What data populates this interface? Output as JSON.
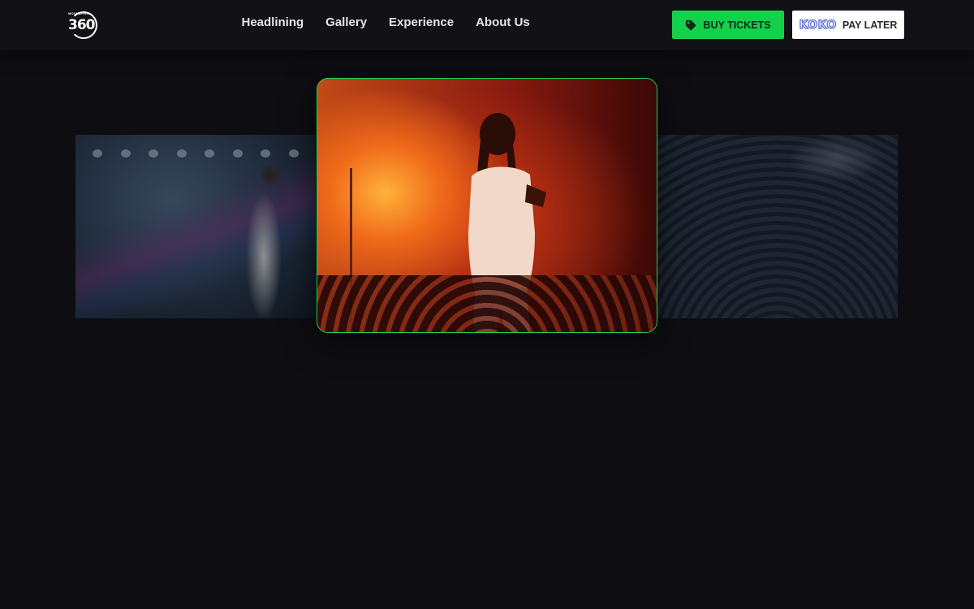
{
  "nav": {
    "items": [
      {
        "label": "Headlining"
      },
      {
        "label": "Gallery"
      },
      {
        "label": "Experience"
      },
      {
        "label": "About Us"
      }
    ]
  },
  "logo": {
    "brand": "MOVASPIRIT",
    "number": "360"
  },
  "actions": {
    "buy_tickets": "BUY TICKETS",
    "koko_brand": "KOKO",
    "pay_later": "PAY LATER"
  },
  "colors": {
    "accent_green": "#14d14c",
    "background": "#0e0e12"
  },
  "icons": {
    "buy": "tag-icon"
  }
}
